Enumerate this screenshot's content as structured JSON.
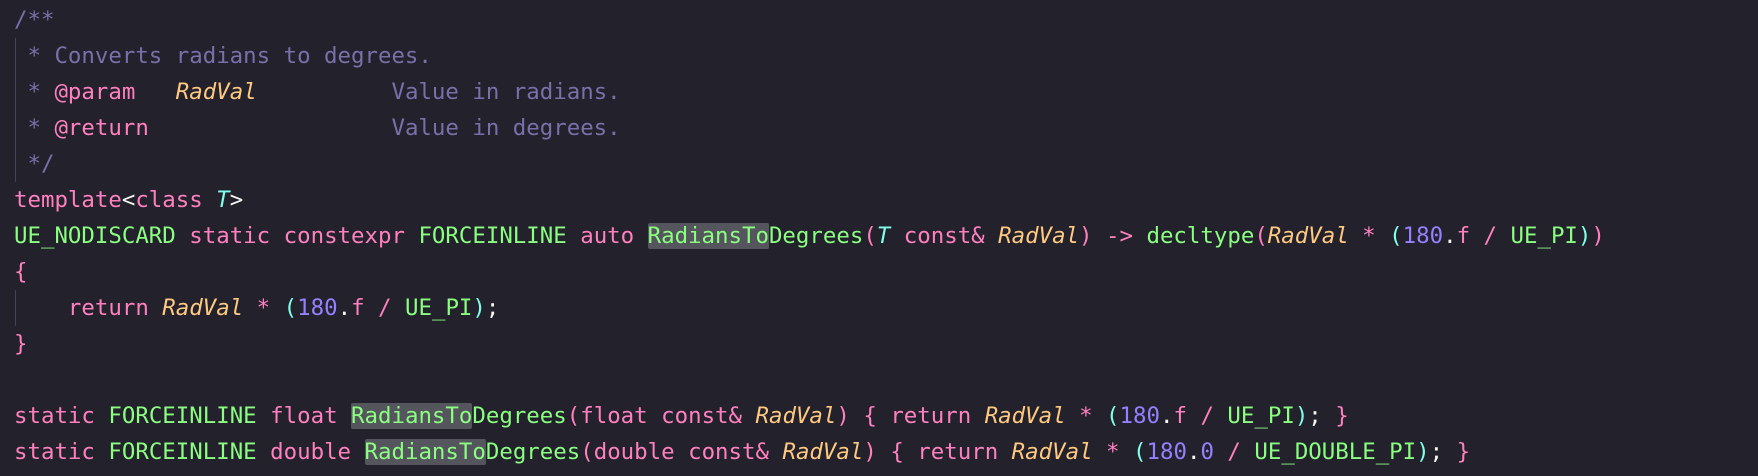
{
  "editor": {
    "theme": {
      "background": "#22212c",
      "comment": "#7970a9",
      "keyword": "#ff80bf",
      "parameter": "#ffca80",
      "type_param": "#80ffea",
      "function": "#8aff80",
      "number": "#9580ff",
      "text": "#f8f8f2",
      "match_highlight": "#55555d"
    },
    "lines": [
      [
        {
          "t": "/**",
          "c": "c-comment"
        }
      ],
      [
        {
          "t": " * Converts radians to degrees.",
          "c": "c-comment"
        }
      ],
      [
        {
          "t": " * ",
          "c": "c-comment"
        },
        {
          "t": "@param",
          "c": "c-keyword"
        },
        {
          "t": "   ",
          "c": "c-comment"
        },
        {
          "t": "RadVal",
          "c": "c-italic-orange"
        },
        {
          "t": "          Value in radians.",
          "c": "c-comment"
        }
      ],
      [
        {
          "t": " * ",
          "c": "c-comment"
        },
        {
          "t": "@return",
          "c": "c-keyword"
        },
        {
          "t": "                  Value in degrees.",
          "c": "c-comment"
        }
      ],
      [
        {
          "t": " */",
          "c": "c-comment"
        }
      ],
      [
        {
          "t": "template",
          "c": "c-keyword"
        },
        {
          "t": "<",
          "c": "c-white"
        },
        {
          "t": "class",
          "c": "c-keyword"
        },
        {
          "t": " ",
          "c": "c-white"
        },
        {
          "t": "T",
          "c": "c-italic-cyan"
        },
        {
          "t": ">",
          "c": "c-white"
        }
      ],
      [
        {
          "t": "UE_NODISCARD",
          "c": "c-green"
        },
        {
          "t": " ",
          "c": "c-white"
        },
        {
          "t": "static",
          "c": "c-keyword"
        },
        {
          "t": " ",
          "c": "c-white"
        },
        {
          "t": "constexpr",
          "c": "c-keyword"
        },
        {
          "t": " ",
          "c": "c-white"
        },
        {
          "t": "FORCEINLINE",
          "c": "c-green"
        },
        {
          "t": " ",
          "c": "c-white"
        },
        {
          "t": "auto",
          "c": "c-keyword"
        },
        {
          "t": " ",
          "c": "c-white"
        },
        {
          "t": "RadiansTo",
          "c": "c-green hl"
        },
        {
          "t": "Degrees",
          "c": "c-green"
        },
        {
          "t": "(",
          "c": "c-keyword"
        },
        {
          "t": "T",
          "c": "c-italic-cyan"
        },
        {
          "t": " ",
          "c": "c-white"
        },
        {
          "t": "const&",
          "c": "c-keyword"
        },
        {
          "t": " ",
          "c": "c-white"
        },
        {
          "t": "RadVal",
          "c": "c-italic-orange"
        },
        {
          "t": ")",
          "c": "c-keyword"
        },
        {
          "t": " ",
          "c": "c-white"
        },
        {
          "t": "->",
          "c": "c-keyword"
        },
        {
          "t": " ",
          "c": "c-white"
        },
        {
          "t": "decltype",
          "c": "c-green"
        },
        {
          "t": "(",
          "c": "c-keyword"
        },
        {
          "t": "RadVal",
          "c": "c-italic-orange"
        },
        {
          "t": " ",
          "c": "c-white"
        },
        {
          "t": "*",
          "c": "c-keyword"
        },
        {
          "t": " ",
          "c": "c-white"
        },
        {
          "t": "(",
          "c": "c-cyan"
        },
        {
          "t": "180",
          "c": "c-purple"
        },
        {
          "t": ".",
          "c": "c-white"
        },
        {
          "t": "f",
          "c": "c-keyword"
        },
        {
          "t": " ",
          "c": "c-white"
        },
        {
          "t": "/",
          "c": "c-keyword"
        },
        {
          "t": " ",
          "c": "c-white"
        },
        {
          "t": "UE_PI",
          "c": "c-green"
        },
        {
          "t": ")",
          "c": "c-cyan"
        },
        {
          "t": ")",
          "c": "c-keyword"
        }
      ],
      [
        {
          "t": "{",
          "c": "c-pink"
        }
      ],
      [
        {
          "t": "    ",
          "c": "c-white"
        },
        {
          "t": "return",
          "c": "c-keyword"
        },
        {
          "t": " ",
          "c": "c-white"
        },
        {
          "t": "RadVal",
          "c": "c-italic-orange"
        },
        {
          "t": " ",
          "c": "c-white"
        },
        {
          "t": "*",
          "c": "c-keyword"
        },
        {
          "t": " ",
          "c": "c-white"
        },
        {
          "t": "(",
          "c": "c-cyan"
        },
        {
          "t": "180",
          "c": "c-purple"
        },
        {
          "t": ".",
          "c": "c-white"
        },
        {
          "t": "f",
          "c": "c-keyword"
        },
        {
          "t": " ",
          "c": "c-white"
        },
        {
          "t": "/",
          "c": "c-keyword"
        },
        {
          "t": " ",
          "c": "c-white"
        },
        {
          "t": "UE_PI",
          "c": "c-green"
        },
        {
          "t": ")",
          "c": "c-cyan"
        },
        {
          "t": ";",
          "c": "c-white"
        }
      ],
      [
        {
          "t": "}",
          "c": "c-pink"
        }
      ],
      [],
      [
        {
          "t": "static",
          "c": "c-keyword"
        },
        {
          "t": " ",
          "c": "c-white"
        },
        {
          "t": "FORCEINLINE",
          "c": "c-green"
        },
        {
          "t": " ",
          "c": "c-white"
        },
        {
          "t": "float",
          "c": "c-keyword"
        },
        {
          "t": " ",
          "c": "c-white"
        },
        {
          "t": "RadiansTo",
          "c": "c-green hl"
        },
        {
          "t": "Degrees",
          "c": "c-green"
        },
        {
          "t": "(",
          "c": "c-keyword"
        },
        {
          "t": "float",
          "c": "c-keyword"
        },
        {
          "t": " ",
          "c": "c-white"
        },
        {
          "t": "const&",
          "c": "c-keyword"
        },
        {
          "t": " ",
          "c": "c-white"
        },
        {
          "t": "RadVal",
          "c": "c-italic-orange"
        },
        {
          "t": ")",
          "c": "c-keyword"
        },
        {
          "t": " ",
          "c": "c-white"
        },
        {
          "t": "{",
          "c": "c-keyword"
        },
        {
          "t": " ",
          "c": "c-white"
        },
        {
          "t": "return",
          "c": "c-keyword"
        },
        {
          "t": " ",
          "c": "c-white"
        },
        {
          "t": "RadVal",
          "c": "c-italic-orange"
        },
        {
          "t": " ",
          "c": "c-white"
        },
        {
          "t": "*",
          "c": "c-keyword"
        },
        {
          "t": " ",
          "c": "c-white"
        },
        {
          "t": "(",
          "c": "c-cyan"
        },
        {
          "t": "180",
          "c": "c-purple"
        },
        {
          "t": ".",
          "c": "c-white"
        },
        {
          "t": "f",
          "c": "c-keyword"
        },
        {
          "t": " ",
          "c": "c-white"
        },
        {
          "t": "/",
          "c": "c-keyword"
        },
        {
          "t": " ",
          "c": "c-white"
        },
        {
          "t": "UE_PI",
          "c": "c-green"
        },
        {
          "t": ")",
          "c": "c-cyan"
        },
        {
          "t": ";",
          "c": "c-white"
        },
        {
          "t": " ",
          "c": "c-white"
        },
        {
          "t": "}",
          "c": "c-keyword"
        }
      ],
      [
        {
          "t": "static",
          "c": "c-keyword"
        },
        {
          "t": " ",
          "c": "c-white"
        },
        {
          "t": "FORCEINLINE",
          "c": "c-green"
        },
        {
          "t": " ",
          "c": "c-white"
        },
        {
          "t": "double",
          "c": "c-keyword"
        },
        {
          "t": " ",
          "c": "c-white"
        },
        {
          "t": "RadiansTo",
          "c": "c-green hl"
        },
        {
          "t": "Degrees",
          "c": "c-green"
        },
        {
          "t": "(",
          "c": "c-keyword"
        },
        {
          "t": "double",
          "c": "c-keyword"
        },
        {
          "t": " ",
          "c": "c-white"
        },
        {
          "t": "const&",
          "c": "c-keyword"
        },
        {
          "t": " ",
          "c": "c-white"
        },
        {
          "t": "RadVal",
          "c": "c-italic-orange"
        },
        {
          "t": ")",
          "c": "c-keyword"
        },
        {
          "t": " ",
          "c": "c-white"
        },
        {
          "t": "{",
          "c": "c-keyword"
        },
        {
          "t": " ",
          "c": "c-white"
        },
        {
          "t": "return",
          "c": "c-keyword"
        },
        {
          "t": " ",
          "c": "c-white"
        },
        {
          "t": "RadVal",
          "c": "c-italic-orange"
        },
        {
          "t": " ",
          "c": "c-white"
        },
        {
          "t": "*",
          "c": "c-keyword"
        },
        {
          "t": " ",
          "c": "c-white"
        },
        {
          "t": "(",
          "c": "c-cyan"
        },
        {
          "t": "180",
          "c": "c-purple"
        },
        {
          "t": ".",
          "c": "c-white"
        },
        {
          "t": "0",
          "c": "c-purple"
        },
        {
          "t": " ",
          "c": "c-white"
        },
        {
          "t": "/",
          "c": "c-keyword"
        },
        {
          "t": " ",
          "c": "c-white"
        },
        {
          "t": "UE_DOUBLE_PI",
          "c": "c-green"
        },
        {
          "t": ")",
          "c": "c-cyan"
        },
        {
          "t": ";",
          "c": "c-white"
        },
        {
          "t": " ",
          "c": "c-white"
        },
        {
          "t": "}",
          "c": "c-keyword"
        }
      ]
    ]
  }
}
